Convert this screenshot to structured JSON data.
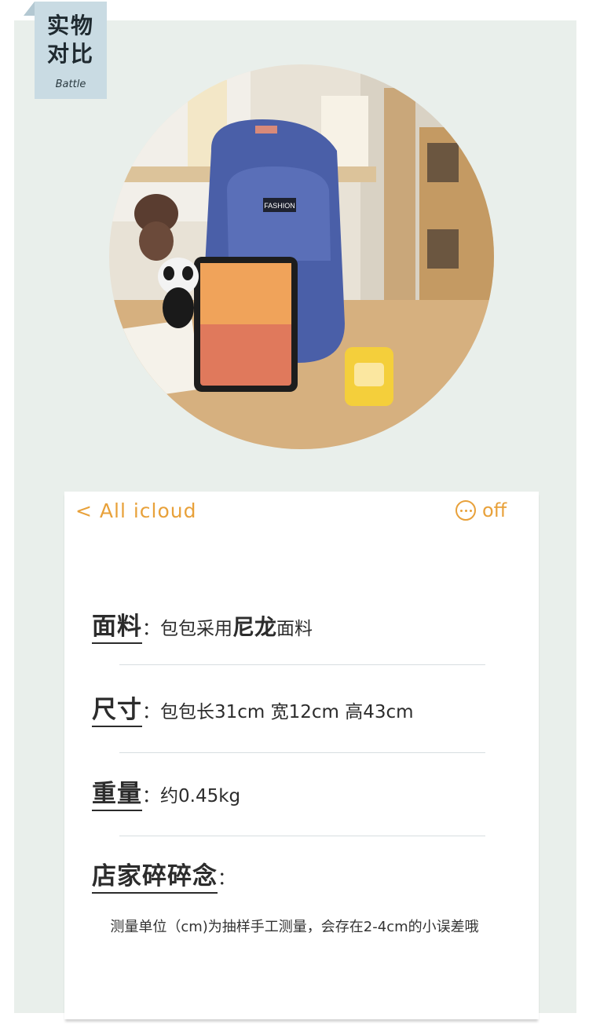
{
  "tag": {
    "line1": "实物",
    "line2": "对比",
    "sub": "Battle"
  },
  "photo": {
    "label": "FASHION"
  },
  "nav": {
    "back_label": "< All icloud",
    "off_label": "off"
  },
  "material": {
    "label": "面料",
    "colon": "：",
    "pre": "包包采用",
    "highlight": "尼龙",
    "post": "面料"
  },
  "size": {
    "label": "尺寸",
    "colon": "：",
    "value": "包包长31cm 宽12cm 高43cm"
  },
  "weight": {
    "label": "重量",
    "colon": "：",
    "value": "约0.45kg"
  },
  "shop": {
    "label": "店家碎碎念",
    "colon": "："
  },
  "note": "测量单位（cm)为抽样手工测量，会存在2-4cm的小误差哦",
  "colors": {
    "accent": "#e8a13a",
    "panel": "#e9efeb",
    "tag": "#c9dbe3",
    "bag": "#4a5fa8"
  },
  "icons": [
    "more-icon",
    "back-chevron-icon"
  ]
}
